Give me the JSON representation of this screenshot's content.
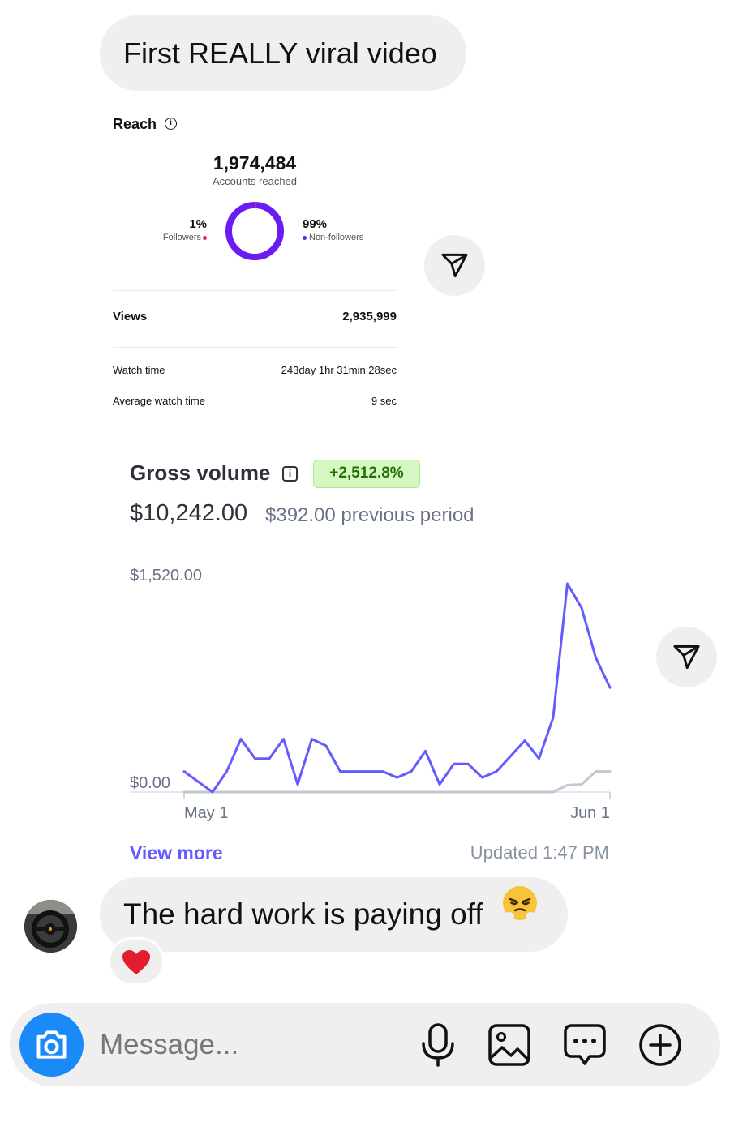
{
  "messages": {
    "top_text": "First REALLY viral video",
    "bottom_text": "The hard work is paying off",
    "bottom_emoji": "face-with-steam-from-nose",
    "reaction": "red-heart"
  },
  "reach_card": {
    "title": "Reach",
    "info_icon": "info-icon",
    "accounts_reached": "1,974,484",
    "accounts_reached_label": "Accounts reached",
    "followers_percent": "1%",
    "followers_label": "Followers",
    "followers_share": 0.01,
    "followers_color": "#e01c8c",
    "non_followers_percent": "99%",
    "non_followers_label": "Non-followers",
    "non_followers_color": "#6a1cf2",
    "views_label": "Views",
    "views_value": "2,935,999",
    "watch_time_label": "Watch time",
    "watch_time_value": "243day 1hr 31min 28sec",
    "average_watch_time_label": "Average watch time",
    "average_watch_time_value": "9 sec"
  },
  "gross_volume": {
    "title": "Gross volume",
    "change_badge": "+2,512.8%",
    "amount": "$10,242.00",
    "previous_period": "$392.00 previous period",
    "view_more": "View more",
    "updated": "Updated 1:47 PM"
  },
  "chart_data": {
    "type": "line",
    "title": "Gross volume",
    "ylim": [
      0,
      1520
    ],
    "y_tick_labels": [
      "$1,520.00",
      "$0.00"
    ],
    "x_tick_labels": [
      "May 1",
      "Jun 1"
    ],
    "grid": false,
    "legend": "none",
    "x_range": [
      "May 1",
      "Jun 1"
    ],
    "series": [
      {
        "color": "#635bff",
        "values": [
          150,
          75,
          0,
          150,
          387,
          244,
          244,
          387,
          56,
          387,
          338,
          150,
          150,
          150,
          150,
          106,
          150,
          300,
          56,
          206,
          206,
          106,
          150,
          262,
          375,
          244,
          544,
          1520,
          1344,
          981,
          762
        ]
      },
      {
        "color": "#c0c8d2",
        "values": [
          0,
          0,
          0,
          0,
          0,
          0,
          0,
          0,
          0,
          0,
          0,
          0,
          0,
          0,
          0,
          0,
          0,
          0,
          0,
          0,
          0,
          0,
          0,
          0,
          0,
          0,
          0,
          50,
          56,
          150,
          150
        ]
      }
    ]
  },
  "composer": {
    "placeholder": "Message...",
    "value": ""
  }
}
